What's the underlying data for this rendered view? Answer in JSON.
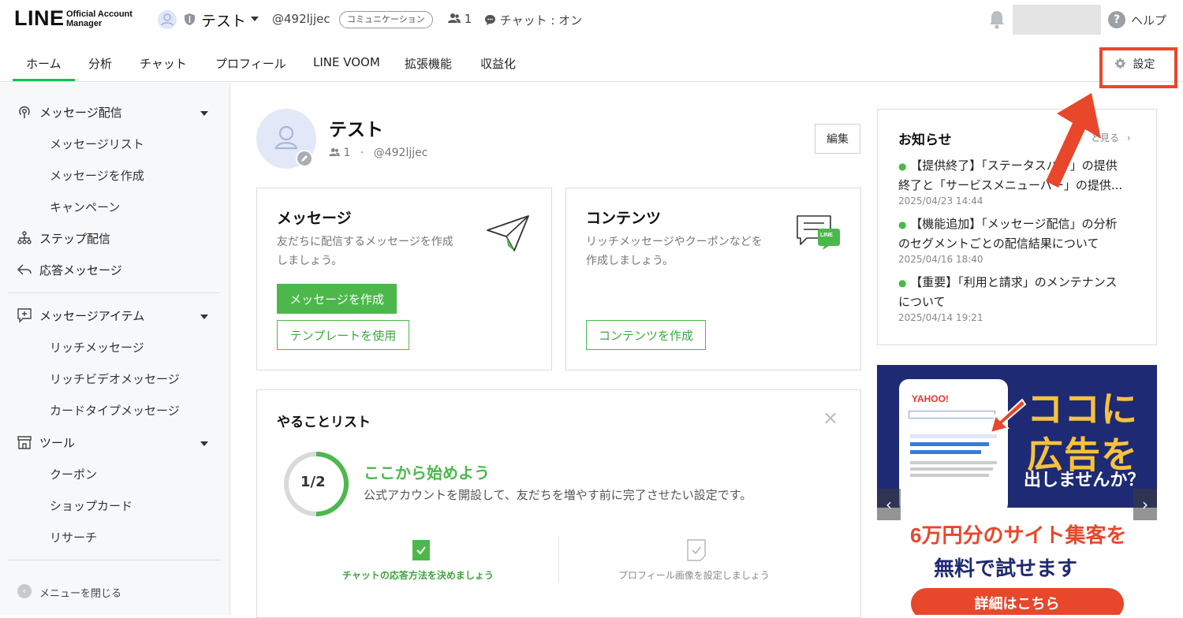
{
  "header": {
    "logo_line": "LINE",
    "logo_sub1": "Official Account",
    "logo_sub2": "Manager",
    "account_name": "テスト",
    "account_id": "@492ljjec",
    "plan_badge": "コミュニケーション",
    "friends_count": "1",
    "chat_status": "チャット : オン",
    "help": "ヘルプ"
  },
  "nav": {
    "tabs": [
      "ホーム",
      "分析",
      "チャット",
      "プロフィール",
      "LINE VOOM",
      "拡張機能",
      "収益化"
    ],
    "settings": "設定"
  },
  "sidebar": {
    "groups": [
      {
        "label": "メッセージ配信",
        "icon": "broadcast-icon",
        "items": [
          "メッセージリスト",
          "メッセージを作成",
          "キャンペーン"
        ]
      },
      {
        "label": "ステップ配信",
        "icon": "step-icon",
        "items": []
      },
      {
        "label": "応答メッセージ",
        "icon": "reply-icon",
        "items": []
      },
      {
        "label": "メッセージアイテム",
        "icon": "message-item-icon",
        "items": [
          "リッチメッセージ",
          "リッチビデオメッセージ",
          "カードタイプメッセージ"
        ]
      },
      {
        "label": "ツール",
        "icon": "tools-icon",
        "items": [
          "クーポン",
          "ショップカード",
          "リサーチ"
        ]
      }
    ],
    "collapse": "メニューを閉じる"
  },
  "profile": {
    "name": "テスト",
    "friends": "1",
    "sep": "·",
    "id": "@492ljjec",
    "edit": "編集"
  },
  "message_card": {
    "title": "メッセージ",
    "desc1": "友だちに配信するメッセージを作成",
    "desc2": "しましょう。",
    "create": "メッセージを作成",
    "template": "テンプレートを使用"
  },
  "content_card": {
    "title": "コンテンツ",
    "desc1": "リッチメッセージやクーポンなどを",
    "desc2": "作成しましょう。",
    "create": "コンテンツを作成",
    "badge": "LINE"
  },
  "todo": {
    "title": "やることリスト",
    "close": "×",
    "progress_label": "1/2",
    "progress_fraction": 0.5,
    "heading": "ここから始めよう",
    "desc": "公式アカウントを開設して、友だちを増やす前に完了させたい設定です。",
    "tasks": [
      {
        "label": "チャットの応答方法を決めましょう",
        "done": true
      },
      {
        "label": "プロフィール画像を設定しましょう",
        "done": false
      }
    ]
  },
  "notices": {
    "title": "お知らせ",
    "more": "と見る",
    "items": [
      {
        "line1": "【提供終了】「ステータスバー」の提供",
        "line2": "終了と「サービスメニューバー」の提供...",
        "date": "2025/04/23 14:44"
      },
      {
        "line1": "【機能追加】「メッセージ配信」の分析",
        "line2": "のセグメントごとの配信結果について",
        "date": "2025/04/16 18:40"
      },
      {
        "line1": "【重要】「利用と請求」のメンテナンス",
        "line2": "について",
        "date": "2025/04/14 19:21"
      }
    ]
  },
  "ad": {
    "headline1": "ココに",
    "headline2": "広告を",
    "headline3": "出しませんか？",
    "offer1": "6万円分のサイト集客を",
    "offer2": "無料で試せます",
    "cta": "詳細はこちら",
    "mock_brand": "YAHOO!"
  },
  "colors": {
    "brand_green": "#06c755",
    "button_green": "#4cb84c",
    "highlight_red": "#e8472b",
    "ad_navy": "#1f2a74",
    "ad_yellow": "#f7c13c"
  }
}
